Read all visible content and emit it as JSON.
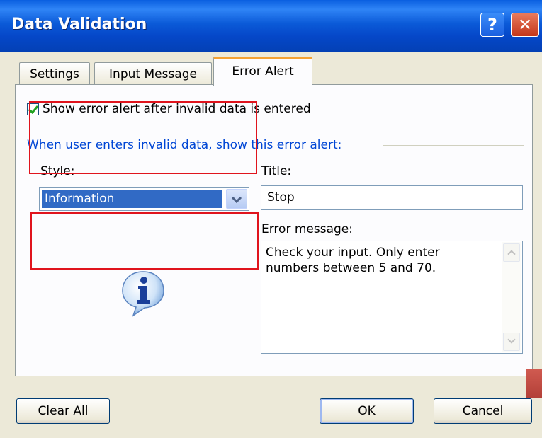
{
  "window": {
    "title": "Data Validation",
    "help_icon": "help-icon",
    "close_icon": "close-icon"
  },
  "tabs": [
    {
      "label": "Settings"
    },
    {
      "label": "Input Message"
    },
    {
      "label": "Error Alert",
      "active": true
    }
  ],
  "error_alert": {
    "show_alert_checked": true,
    "show_alert_label": "Show error alert after invalid data is entered",
    "group_label": "When user enters invalid data, show this error alert:",
    "style_label": "Style:",
    "style_value": "Information",
    "title_label": "Title:",
    "title_value": "Stop",
    "message_label": "Error message:",
    "message_value": "Check your input. Only enter\nnumbers between 5 and 70.",
    "style_icon": "information-icon"
  },
  "buttons": {
    "clear_all": "Clear All",
    "ok": "OK",
    "cancel": "Cancel"
  },
  "colors": {
    "titlebar": "#0a5fe0",
    "group_label": "#0046d5",
    "selection": "#316ac5",
    "highlight_box": "#e0141d"
  }
}
